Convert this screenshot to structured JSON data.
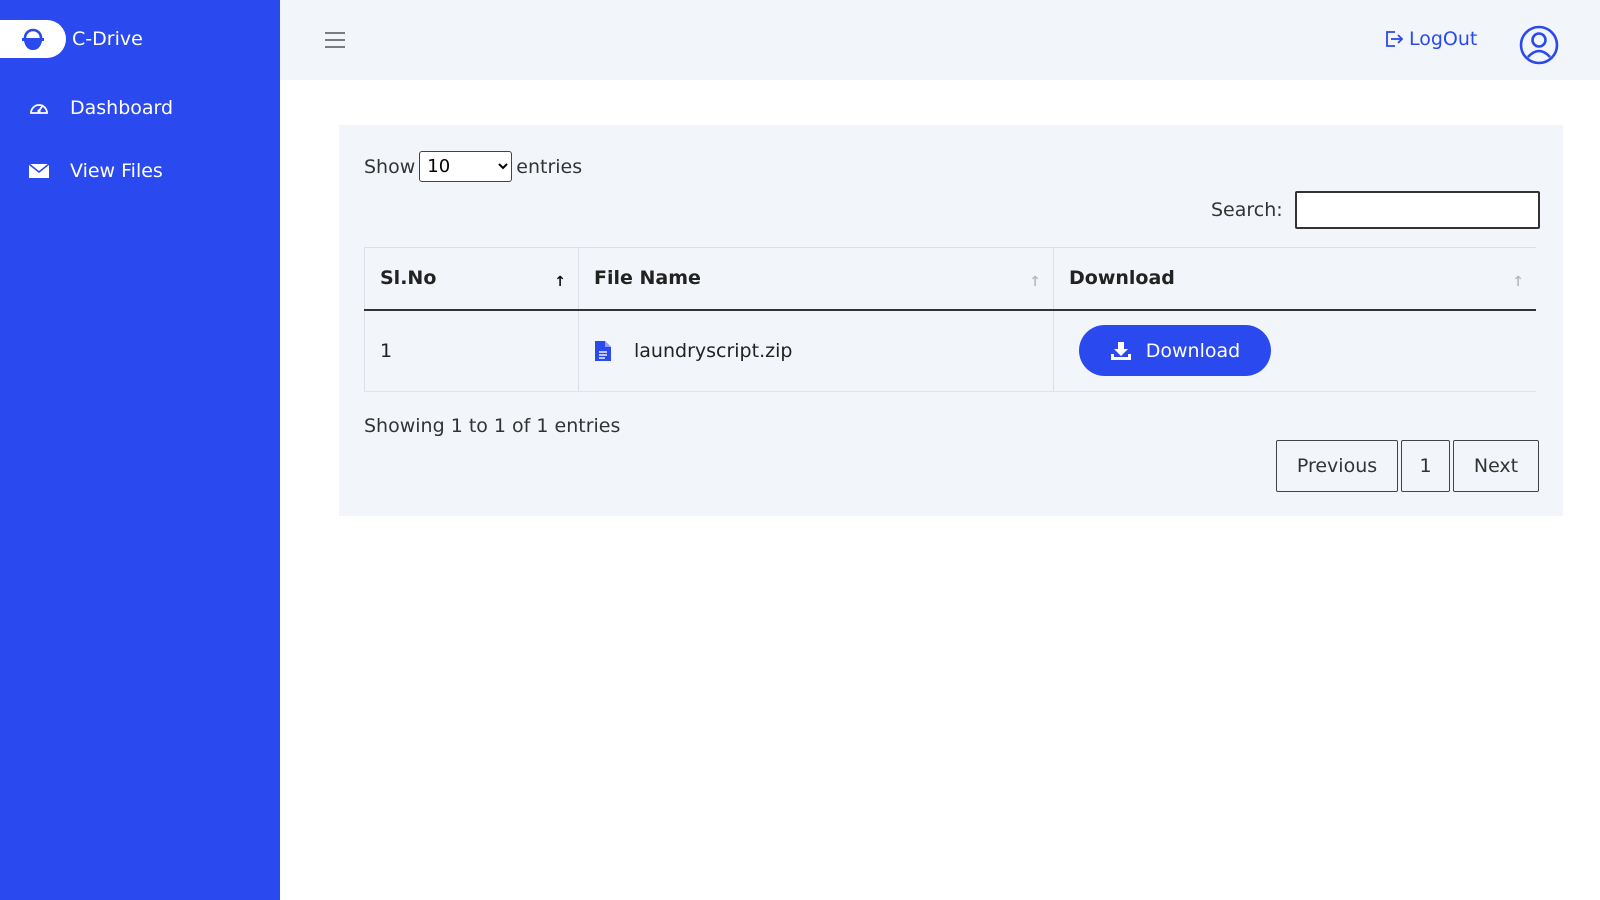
{
  "app": {
    "brand": "C-Drive"
  },
  "sidebar": {
    "items": [
      {
        "label": "Dashboard",
        "icon": "speedometer-icon"
      },
      {
        "label": "View Files",
        "icon": "envelope-icon"
      }
    ]
  },
  "header": {
    "logout_label": "LogOut",
    "menu_icon": "hamburger-icon",
    "avatar_icon": "user-circle-icon"
  },
  "table_controls": {
    "show_label": "Show",
    "entries_label": "entries",
    "page_length": "10",
    "page_length_options": [
      "10"
    ],
    "search_label": "Search:",
    "search_value": ""
  },
  "table": {
    "columns": [
      "Sl.No",
      "File Name",
      "Download"
    ],
    "rows": [
      {
        "sl_no": "1",
        "file_name": "laundryscript.zip",
        "action": "Download"
      }
    ]
  },
  "footer": {
    "info": "Showing 1 to 1 of 1 entries",
    "prev_label": "Previous",
    "page": "1",
    "next_label": "Next"
  },
  "colors": {
    "accent": "#2a49ee",
    "panel": "#f2f5fa"
  }
}
